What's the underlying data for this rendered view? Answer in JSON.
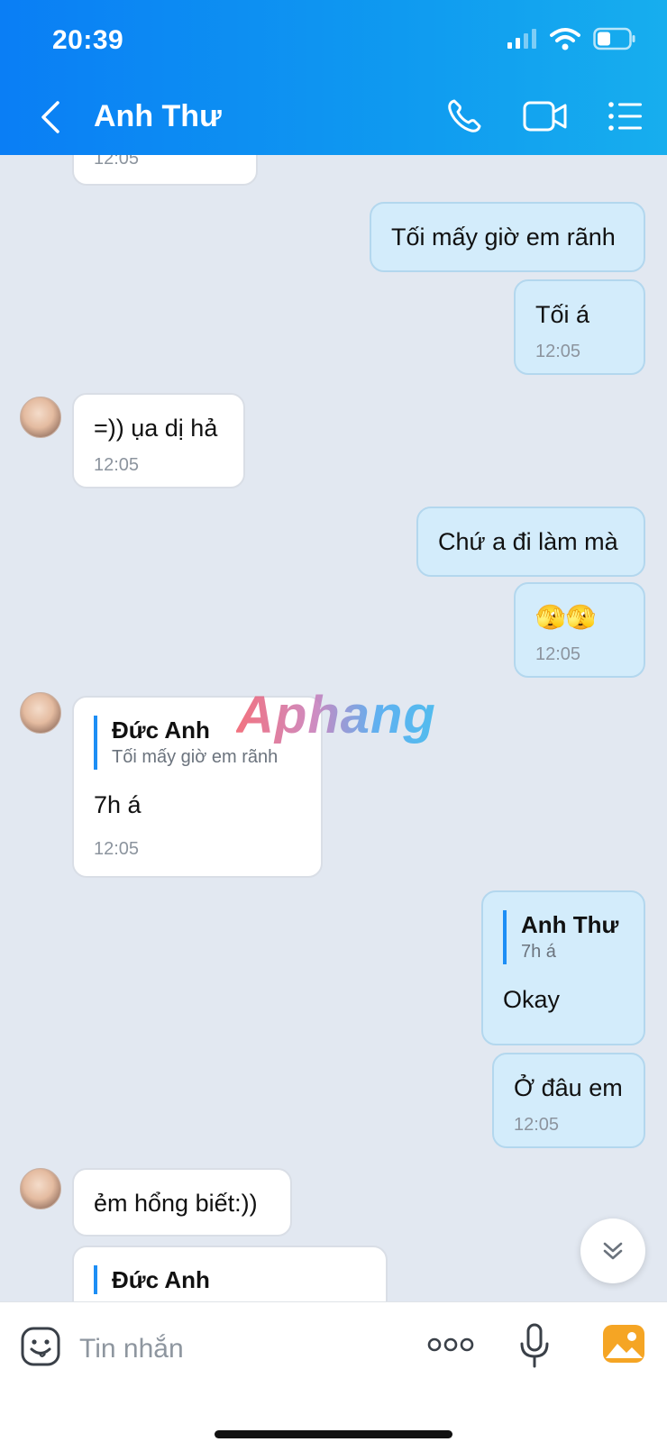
{
  "status": {
    "time": "20:39"
  },
  "header": {
    "title": "Anh Thư"
  },
  "messages": {
    "m0": {
      "time": "12:05"
    },
    "m1": {
      "text": "Tối mấy giờ em rãnh"
    },
    "m2": {
      "text": "Tối á",
      "time": "12:05"
    },
    "m3": {
      "text": "=)) ụa dị hả",
      "time": "12:05"
    },
    "m4": {
      "text": "Chứ a đi làm mà"
    },
    "m5": {
      "text": "🫣🫣",
      "time": "12:05"
    },
    "m6": {
      "quote_name": "Đức Anh",
      "quote_text": "Tối mấy giờ em rãnh",
      "text": "7h á",
      "time": "12:05"
    },
    "m7": {
      "quote_name": "Anh Thư",
      "quote_text": "7h á",
      "text": "Okay"
    },
    "m8": {
      "text": "Ở đâu em",
      "time": "12:05"
    },
    "m9": {
      "text": "ẻm hổng biết:))"
    },
    "m10": {
      "quote_name": "Đức Anh"
    }
  },
  "watermark": "Aphang",
  "composer": {
    "placeholder": "Tin nhắn"
  },
  "colors": {
    "header": "#0a7ef5",
    "outgoing_bubble": "#d3ecfb",
    "incoming_bubble": "#ffffff",
    "background": "#e2e8f1",
    "quote_bar": "#1d8ef5"
  },
  "icons": [
    "back-chevron-icon",
    "phone-icon",
    "video-icon",
    "list-icon",
    "emoji-icon",
    "more-dots-icon",
    "microphone-icon",
    "photo-icon",
    "chevron-double-down-icon"
  ]
}
